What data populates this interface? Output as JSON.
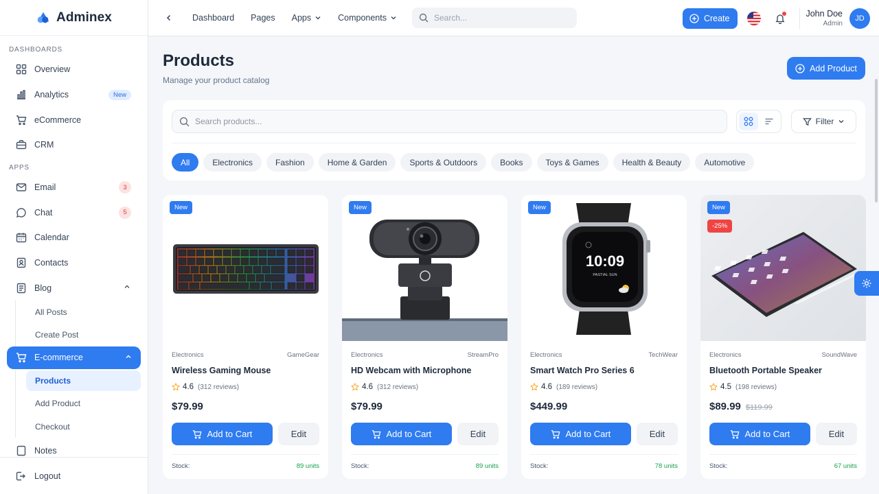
{
  "brand": {
    "name": "Adminex"
  },
  "sidebar": {
    "sections": {
      "dashboards": "DASHBOARDS",
      "apps": "APPS"
    },
    "dashboards": [
      {
        "label": "Overview",
        "icon": "grid-icon"
      },
      {
        "label": "Analytics",
        "icon": "bar-chart-icon",
        "badge": "New"
      },
      {
        "label": "eCommerce",
        "icon": "cart-icon"
      },
      {
        "label": "CRM",
        "icon": "briefcase-icon"
      }
    ],
    "apps": [
      {
        "label": "Email",
        "icon": "mail-icon",
        "badge": "3"
      },
      {
        "label": "Chat",
        "icon": "chat-icon",
        "badge": "5"
      },
      {
        "label": "Calendar",
        "icon": "calendar-icon"
      },
      {
        "label": "Contacts",
        "icon": "contacts-icon"
      },
      {
        "label": "Blog",
        "icon": "document-icon"
      }
    ],
    "blog_sub": [
      "All Posts",
      "Create Post"
    ],
    "ecommerce": {
      "label": "E-commerce",
      "icon": "cart-icon"
    },
    "ecommerce_sub": [
      "Products",
      "Add Product",
      "Checkout"
    ],
    "next_item": "Notes",
    "logout": "Logout"
  },
  "topbar": {
    "links": [
      "Dashboard",
      "Pages",
      "Apps",
      "Components"
    ],
    "search_placeholder": "Search...",
    "create_label": "Create",
    "user": {
      "name": "John Doe",
      "role": "Admin",
      "initials": "JD"
    }
  },
  "page": {
    "title": "Products",
    "subtitle": "Manage your product catalog",
    "add_button": "Add Product",
    "search_placeholder": "Search products...",
    "filter_label": "Filter",
    "categories": [
      "All",
      "Electronics",
      "Fashion",
      "Home & Garden",
      "Sports & Outdoors",
      "Books",
      "Toys & Games",
      "Health & Beauty",
      "Automotive"
    ],
    "active_category": "All"
  },
  "products": [
    {
      "name": "Wireless Gaming Mouse",
      "category": "Electronics",
      "brand": "GameGear",
      "rating": "4.6",
      "reviews": "(312 reviews)",
      "price": "$79.99",
      "old_price": "",
      "tag": "New",
      "discount": "",
      "stock_label": "Stock:",
      "stock": "89 units",
      "image": "keyboard"
    },
    {
      "name": "HD Webcam with Microphone",
      "category": "Electronics",
      "brand": "StreamPro",
      "rating": "4.6",
      "reviews": "(312 reviews)",
      "price": "$79.99",
      "old_price": "",
      "tag": "New",
      "discount": "",
      "stock_label": "Stock:",
      "stock": "89 units",
      "image": "webcam"
    },
    {
      "name": "Smart Watch Pro Series 6",
      "category": "Electronics",
      "brand": "TechWear",
      "rating": "4.6",
      "reviews": "(189 reviews)",
      "price": "$449.99",
      "old_price": "",
      "tag": "New",
      "discount": "",
      "stock_label": "Stock:",
      "stock": "78 units",
      "image": "watch"
    },
    {
      "name": "Bluetooth Portable Speaker",
      "category": "Electronics",
      "brand": "SoundWave",
      "rating": "4.5",
      "reviews": "(198 reviews)",
      "price": "$89.99",
      "old_price": "$119.99",
      "tag": "New",
      "discount": "-25%",
      "stock_label": "Stock:",
      "stock": "67 units",
      "image": "tablet"
    }
  ],
  "card_actions": {
    "add_to_cart": "Add to Cart",
    "edit": "Edit"
  },
  "watch_face": {
    "time": "10:09",
    "sub": "PASTIAL SUN"
  },
  "colors": {
    "primary": "#2f7bf0",
    "danger": "#ef4444",
    "success": "#16a34a"
  }
}
